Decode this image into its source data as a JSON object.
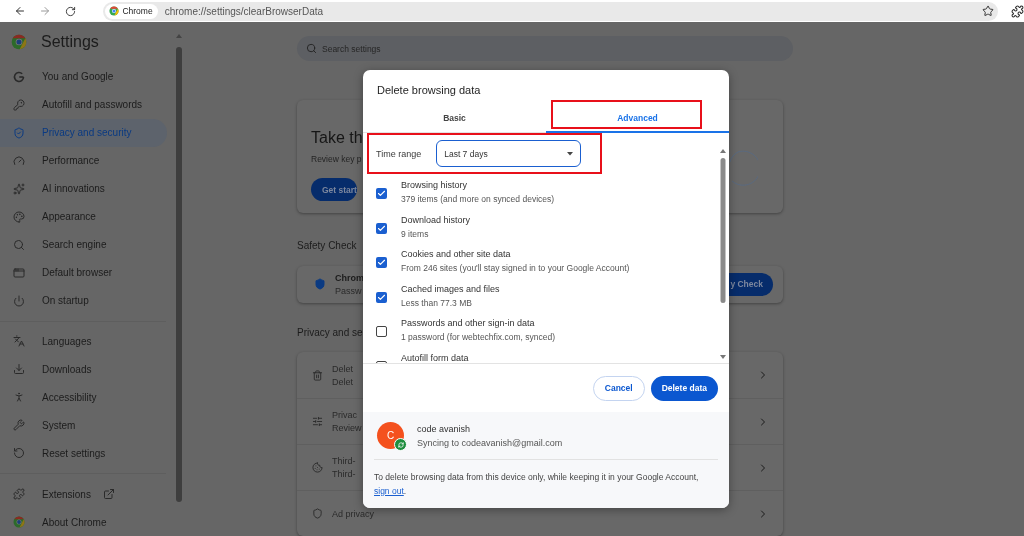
{
  "browser": {
    "chip": "Chrome",
    "url": "chrome://settings/clearBrowserData"
  },
  "sidebar": {
    "title": "Settings",
    "groups": [
      {
        "items": [
          {
            "label": "You and Google",
            "selected": false
          },
          {
            "label": "Autofill and passwords",
            "selected": false
          },
          {
            "label": "Privacy and security",
            "selected": true
          },
          {
            "label": "Performance",
            "selected": false
          },
          {
            "label": "AI innovations",
            "selected": false
          },
          {
            "label": "Appearance",
            "selected": false
          },
          {
            "label": "Search engine",
            "selected": false
          },
          {
            "label": "Default browser",
            "selected": false
          },
          {
            "label": "On startup",
            "selected": false
          }
        ]
      },
      {
        "items": [
          {
            "label": "Languages",
            "selected": false
          },
          {
            "label": "Downloads",
            "selected": false
          },
          {
            "label": "Accessibility",
            "selected": false
          },
          {
            "label": "System",
            "selected": false
          },
          {
            "label": "Reset settings",
            "selected": false
          }
        ]
      },
      {
        "items": [
          {
            "label": "Extensions",
            "selected": false,
            "external": true
          },
          {
            "label": "About Chrome",
            "selected": false,
            "external": false
          }
        ]
      }
    ]
  },
  "search": {
    "placeholder": "Search settings"
  },
  "main": {
    "promo": {
      "title": "Take th",
      "text": "Review key p",
      "button": "Get start"
    },
    "safety_heading": "Safety Check",
    "safety": {
      "title": "Chrom",
      "text": "Passw",
      "button": "y Check"
    },
    "privacy_heading": "Privacy and se",
    "privacy_rows": [
      {
        "title": "Delet",
        "text": "Delet"
      },
      {
        "title": "Privac",
        "text": "Review"
      },
      {
        "title": "Third-",
        "text": "Third-"
      },
      {
        "title": "Ad privacy"
      }
    ]
  },
  "dialog": {
    "title": "Delete browsing data",
    "tabs": [
      {
        "label": "Basic",
        "selected": false
      },
      {
        "label": "Advanced",
        "selected": true
      }
    ],
    "time_range": {
      "label": "Time range",
      "value": "Last 7 days"
    },
    "items": [
      {
        "title": "Browsing history",
        "detail": "379 items (and more on synced devices)",
        "checked": true
      },
      {
        "title": "Download history",
        "detail": "9 items",
        "checked": true
      },
      {
        "title": "Cookies and other site data",
        "detail": "From 246 sites (you'll stay signed in to your Google Account)",
        "checked": true
      },
      {
        "title": "Cached images and files",
        "detail": "Less than 77.3 MB",
        "checked": true
      },
      {
        "title": "Passwords and other sign-in data",
        "detail": "1 password (for webtechfix.com, synced)",
        "checked": false
      },
      {
        "title": "Autofill form data",
        "checked": false
      }
    ],
    "buttons": [
      {
        "label": "Cancel",
        "kind": "secondary"
      },
      {
        "label": "Delete data",
        "kind": "primary"
      }
    ],
    "account": {
      "initial": "C",
      "name": "code avanish",
      "status": "Syncing to codeavanish@gmail.com"
    },
    "note": {
      "text": "To delete browsing data from this device only, while keeping it in your Google Account, ",
      "link": "sign out",
      "after": "."
    }
  }
}
